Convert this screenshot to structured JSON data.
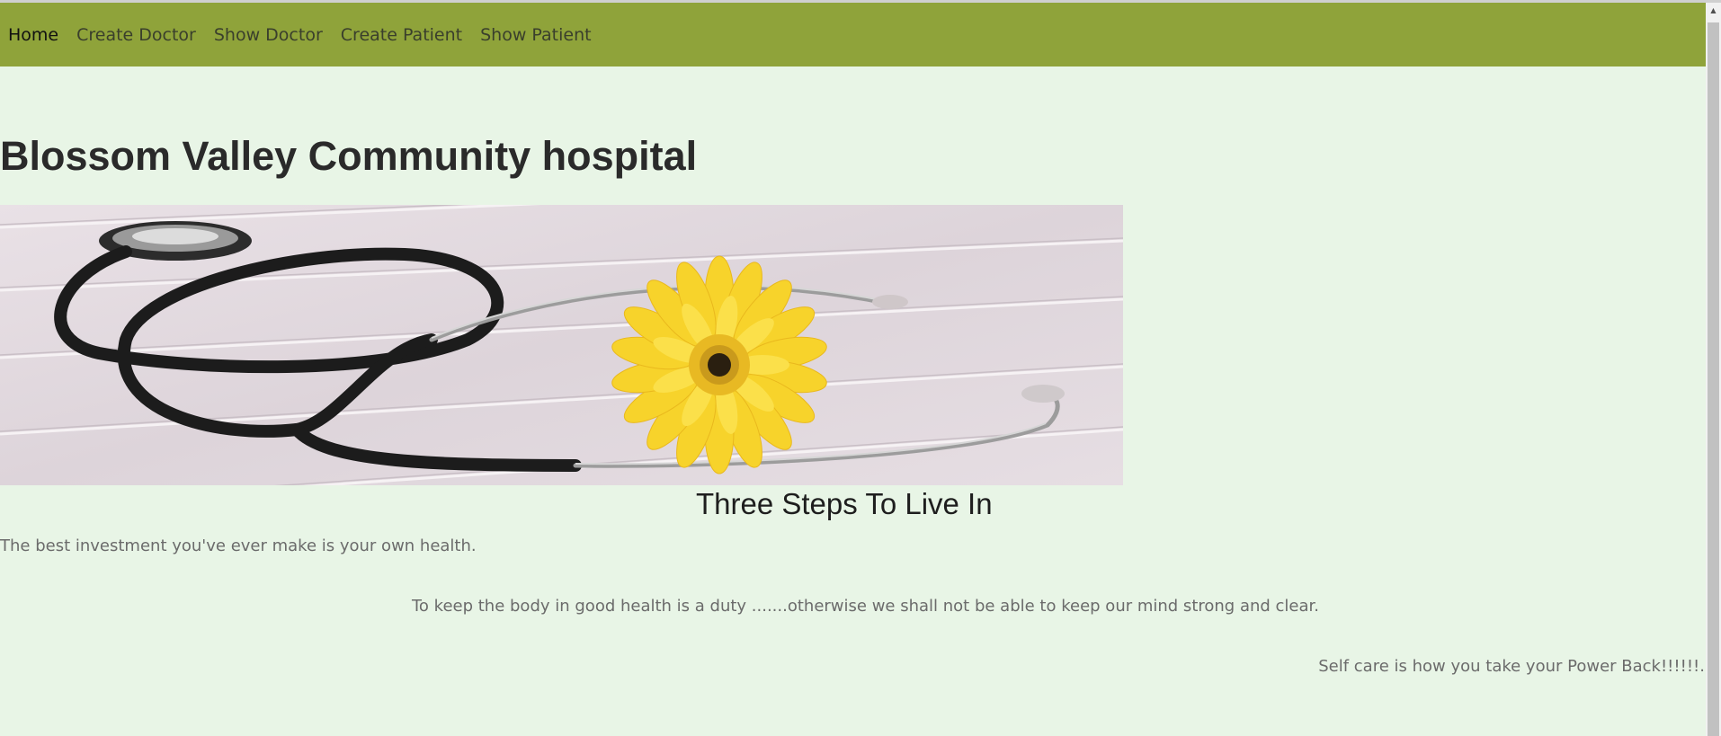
{
  "nav": {
    "items": [
      {
        "label": "Home",
        "active": true
      },
      {
        "label": "Create Doctor",
        "active": false
      },
      {
        "label": "Show Doctor",
        "active": false
      },
      {
        "label": "Create Patient",
        "active": false
      },
      {
        "label": "Show Patient",
        "active": false
      }
    ]
  },
  "main": {
    "title": "Blossom Valley Community hospital",
    "subtitle": "Three Steps To Live In",
    "paragraphs": [
      "The best investment you've ever make is your own health.",
      "To keep the body in good health is a duty .......otherwise we shall not be able to keep our mind strong and clear.",
      "Self care is how you take your Power Back!!!!!!."
    ]
  },
  "colors": {
    "navbar": "#8fa33a",
    "background": "#e8f5e6",
    "flower": "#f7d32b",
    "stethoscope": "#1e1e1e"
  },
  "icons": {
    "banner": "stethoscope-with-yellow-gerbera-image",
    "scroll_up": "scroll-up-arrow-icon"
  }
}
